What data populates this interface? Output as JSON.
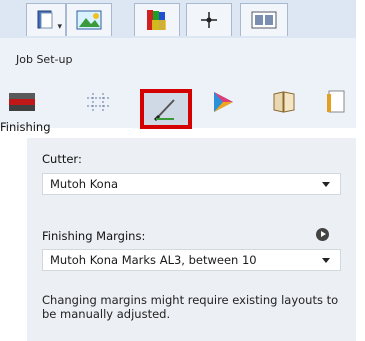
{
  "toolbar": {
    "tabs": [
      {
        "name": "book",
        "icon": "book-icon"
      },
      {
        "name": "image",
        "icon": "picture-icon"
      },
      {
        "name": "swatch",
        "icon": "swatch-icon"
      },
      {
        "name": "target",
        "icon": "crosshair-icon"
      },
      {
        "name": "layout",
        "icon": "layout-icon"
      }
    ]
  },
  "job_setup": {
    "label": "Job Set-up",
    "icons": [
      "media-icon",
      "grid-icon",
      "knife-icon",
      "color-icon",
      "book-stack-icon",
      "document-icon"
    ],
    "selected_icon": "knife-icon"
  },
  "finishing": {
    "title": "Finishing",
    "cutter_label": "Cutter:",
    "cutter_value": "Mutoh Kona",
    "margins_label": "Finishing Margins:",
    "margins_value": "Mutoh Kona Marks AL3, between 10",
    "note": "Changing margins might require existing layouts to be manually adjusted."
  },
  "colors": {
    "selection_border": "#d40000",
    "toolbar_bg": "#dde7f3",
    "panel_bg": "#eceff3"
  }
}
